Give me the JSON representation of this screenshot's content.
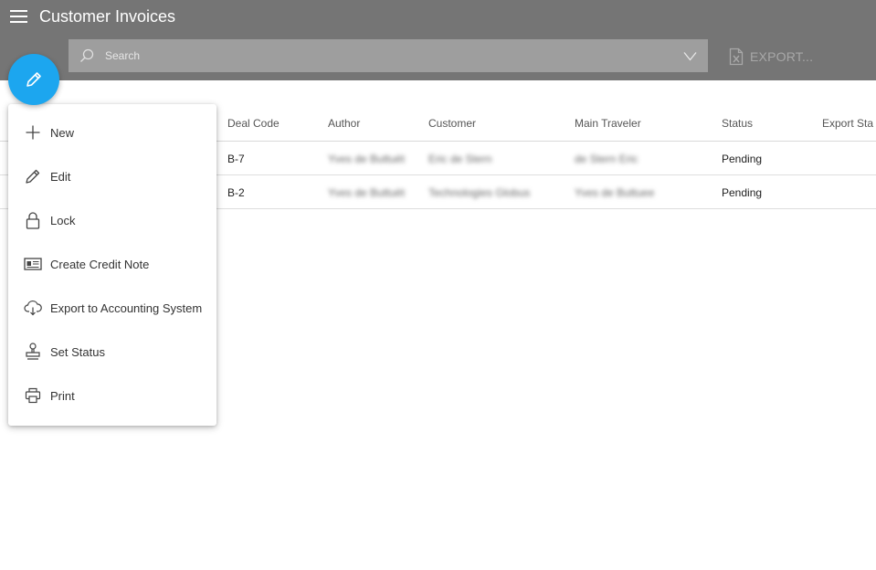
{
  "header": {
    "title": "Customer Invoices",
    "search_placeholder": "Search",
    "export_label": "EXPORT..."
  },
  "colors": {
    "header_bg": "#757575",
    "fab": "#1ca6ef"
  },
  "table": {
    "columns": [
      "Deal Code",
      "Author",
      "Customer",
      "Main Traveler",
      "Status",
      "Export Sta"
    ],
    "rows": [
      {
        "deal_code": "B-7",
        "author": "Yves de Buttuët",
        "customer": "Eric de Stern",
        "main_traveler": "de Stern Eric",
        "status": "Pending"
      },
      {
        "deal_code": "B-2",
        "author": "Yves de Buttuët",
        "customer": "Technologies Globus",
        "main_traveler": "Yves de Buttuee",
        "status": "Pending"
      }
    ]
  },
  "menu": {
    "items": [
      {
        "label": "New",
        "icon": "plus-icon"
      },
      {
        "label": "Edit",
        "icon": "pencil-icon"
      },
      {
        "label": "Lock",
        "icon": "lock-icon"
      },
      {
        "label": "Create Credit Note",
        "icon": "id-card-icon"
      },
      {
        "label": "Export to Accounting System",
        "icon": "cloud-download-icon"
      },
      {
        "label": "Set Status",
        "icon": "stamp-icon"
      },
      {
        "label": "Print",
        "icon": "printer-icon"
      }
    ]
  }
}
